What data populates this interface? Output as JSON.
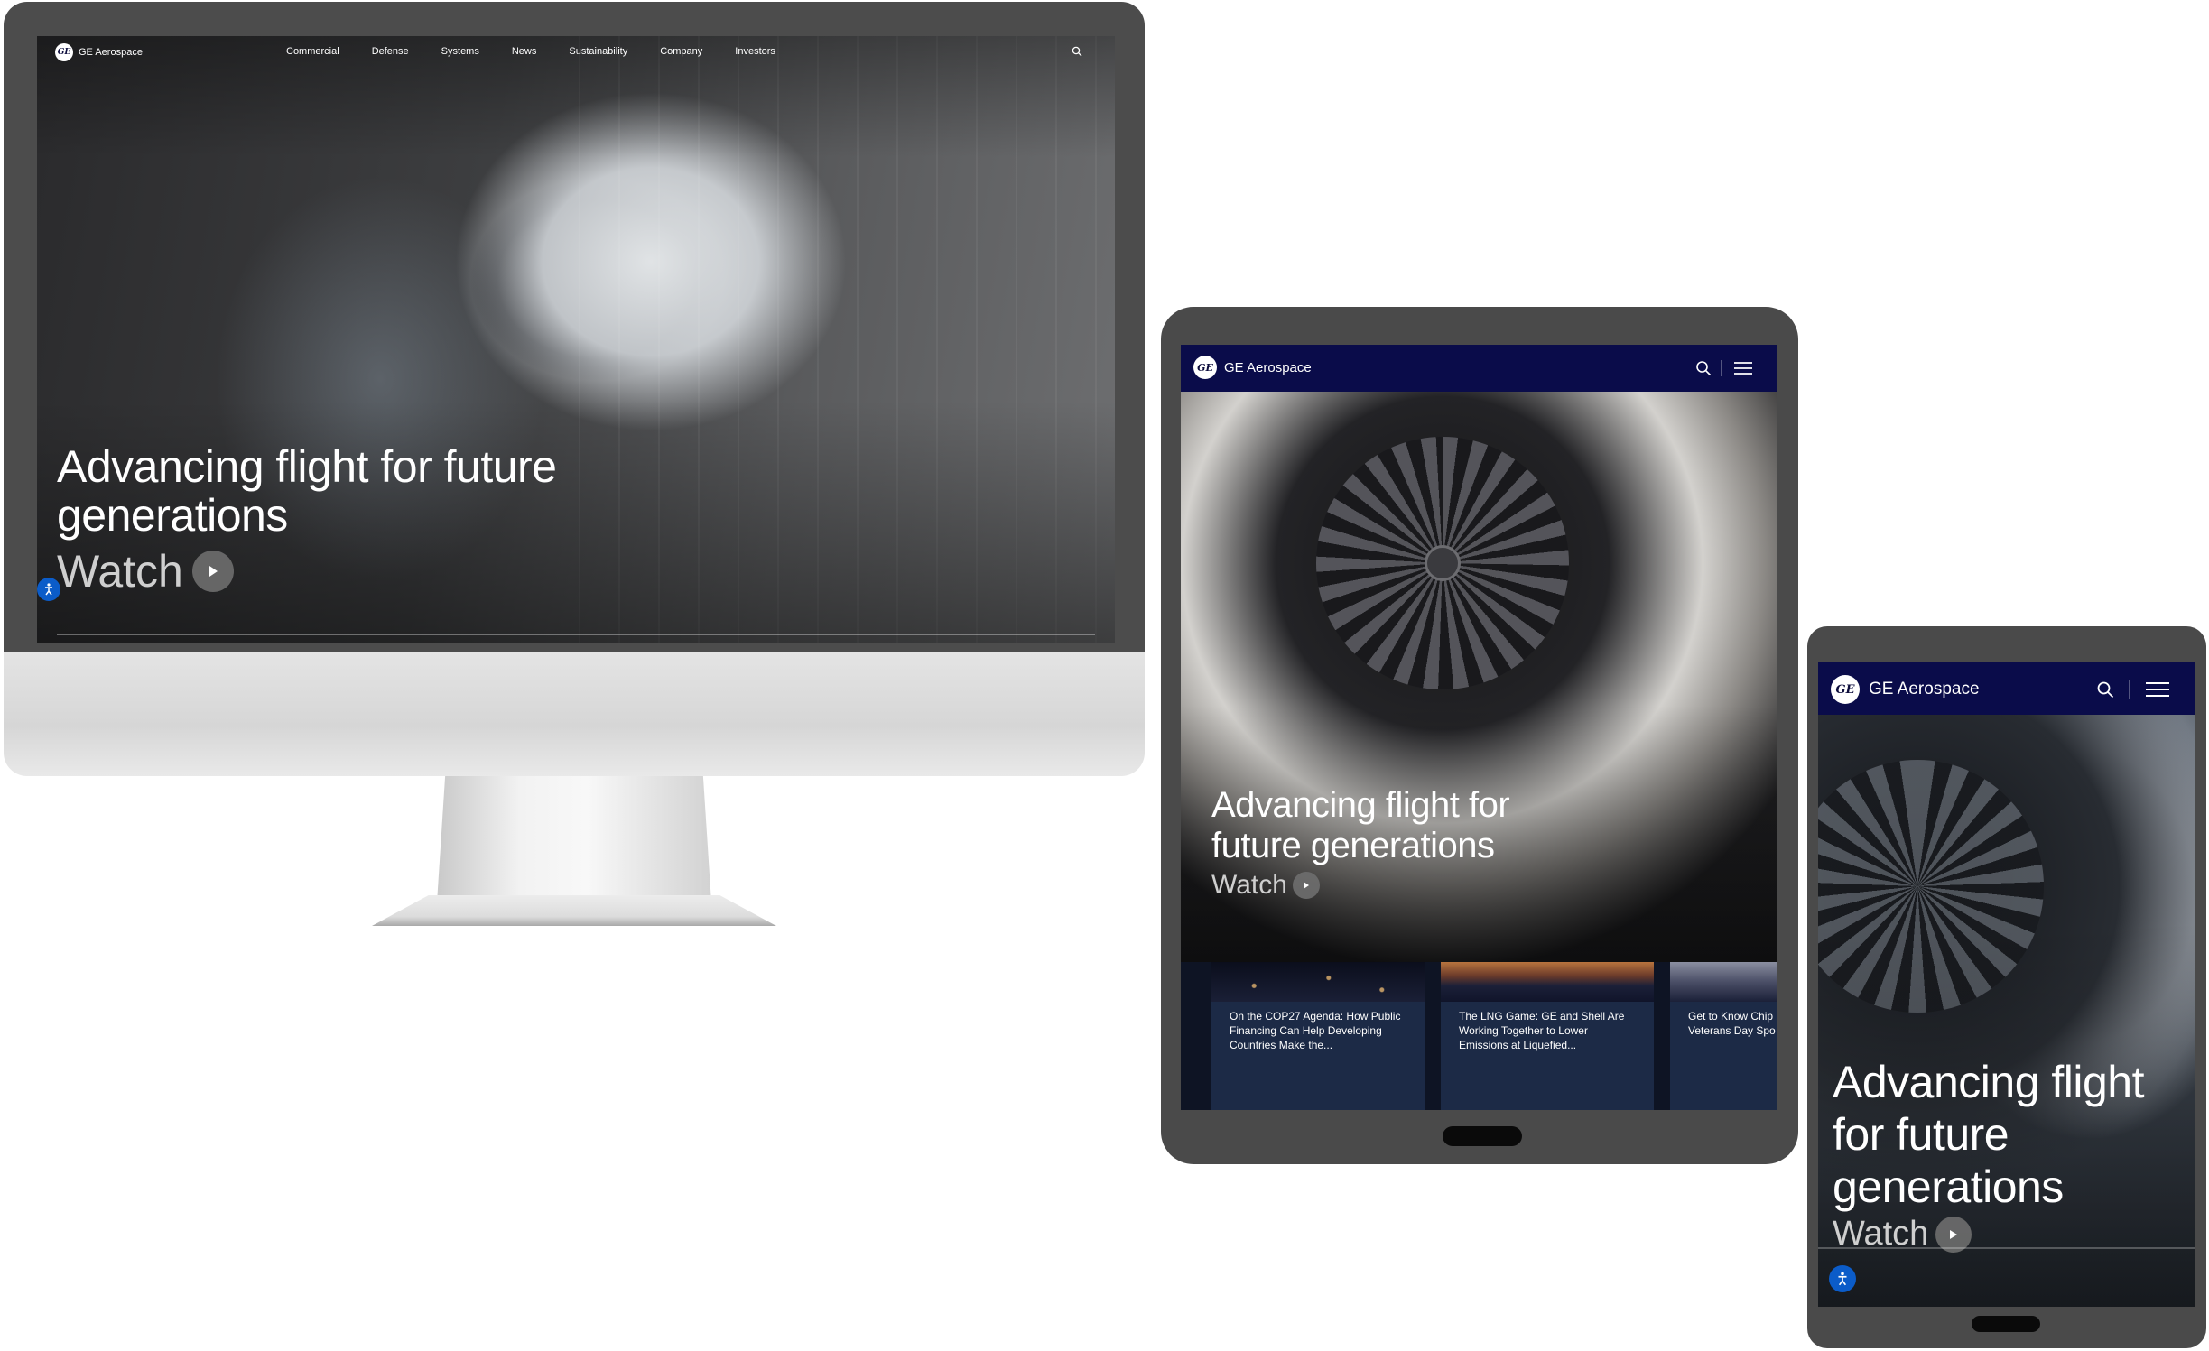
{
  "brand": {
    "name": "GE Aerospace",
    "logo_text": "GE"
  },
  "desktop": {
    "nav": {
      "links": [
        "Commercial",
        "Defense",
        "Systems",
        "News",
        "Sustainability",
        "Company",
        "Investors"
      ]
    },
    "hero": {
      "title": "Advancing flight for future generations",
      "watch_label": "Watch"
    }
  },
  "tablet": {
    "hero": {
      "title": "Advancing flight for future generations",
      "watch_label": "Watch"
    },
    "cards": [
      {
        "text": "On the COP27 Agenda: How Public Financing Can Help Developing Countries Make the..."
      },
      {
        "text": "The LNG Game: GE and Shell Are Working Together to Lower Emissions at Liquefied..."
      },
      {
        "text": "Get to Know Chip Veterans Day Spo"
      }
    ]
  },
  "phone": {
    "hero": {
      "title": "Advancing flight for future generations",
      "watch_label": "Watch"
    }
  },
  "icons": {
    "search": "search-icon",
    "menu": "hamburger-menu-icon",
    "play": "play-icon",
    "accessibility": "accessibility-icon"
  },
  "colors": {
    "nav_bar": "#0a0c4a",
    "card_bg": "#1c2a46",
    "accessibility": "#0b5cc9",
    "device_frame": "#4a4a4a"
  }
}
